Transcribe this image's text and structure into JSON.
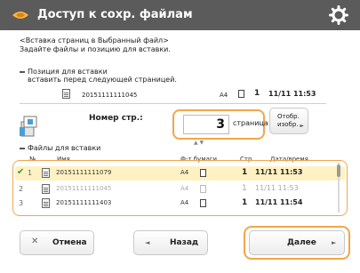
{
  "titlebar": {
    "title": "Доступ к сохр. файлам",
    "app_icon": "stored-files-icon",
    "settings_icon": "gear-icon"
  },
  "instructions": {
    "line1": "<Вставка страниц в Выбранный файл>",
    "line2": "Задайте файлы и позицию для вставки."
  },
  "insert_position": {
    "section_label": "Позиция для вставки",
    "subtitle": "вставить перед следующей страницей.",
    "file": {
      "name": "20151111111045",
      "format": "A4",
      "pages": "1",
      "date": "11/11 11:53"
    }
  },
  "page_select": {
    "label": "Номер стр.:",
    "value": "3",
    "unit": "страница",
    "check_button": "Отобр. изобр."
  },
  "files_to_insert": {
    "section_label": "Файлы для вставки",
    "headers": [
      "№",
      "Имя",
      "Ф-т бумаги",
      "Стр.",
      "Дата/время"
    ],
    "rows": [
      {
        "num": "1",
        "name": "20151111111079",
        "format": "A4",
        "pages": "1",
        "date": "11/11 11:53",
        "selected": true
      },
      {
        "num": "2",
        "name": "20151111111045",
        "format": "A4",
        "pages": "1",
        "date": "11/11 11:53",
        "selected": false
      },
      {
        "num": "3",
        "name": "20151111111403",
        "format": "A4",
        "pages": "1",
        "date": "11/11 11:54",
        "selected": false
      }
    ]
  },
  "footer": {
    "cancel": "Отмена",
    "back": "Назад",
    "next": "Далее"
  },
  "colors": {
    "titlebar": "#5b5b5b",
    "accent": "#f2a64a",
    "selected_row": "#fff1c2"
  }
}
